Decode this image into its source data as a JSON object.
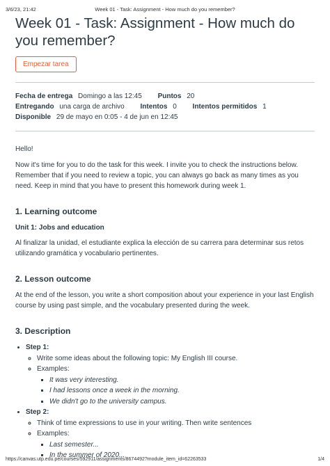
{
  "print_header": {
    "datetime": "3/6/23, 21:42",
    "page_title": "Week 01 - Task: Assignment - How much do you remember?"
  },
  "title": "Week 01 - Task: Assignment - How much do you remember?",
  "start_button": "Empezar tarea",
  "details": {
    "due_label": "Fecha de entrega",
    "due_value": "Domingo a las 12:45",
    "points_label": "Puntos",
    "points_value": "20",
    "submitting_label": "Entregando",
    "submitting_value": "una carga de archivo",
    "attempts_label": "Intentos",
    "attempts_value": "0",
    "allowed_label": "Intentos permitidos",
    "allowed_value": "1",
    "available_label": "Disponible",
    "available_value": "29 de mayo en 0:05 - 4 de jun en 12:45"
  },
  "intro": {
    "greeting": "Hello!",
    "paragraph": "Now it's time for you to do the task for this week. I invite you to check the instructions below. Remember that if you need to review a topic, you can always go back as many times as you need. Keep in mind that you have to present this homework during week 1."
  },
  "section1": {
    "heading": "1. Learning outcome",
    "subheading": "Unit 1: Jobs and education",
    "text": "Al finalizar la unidad, el estudiante explica la elección de su carrera para determinar sus retos utilizando gramática y vocabulario pertinentes."
  },
  "section2": {
    "heading": "2. Lesson outcome",
    "text": "At the end of the lesson, you write a short composition about your experience in your last English course by using past simple, and the vocabulary presented during the week."
  },
  "section3": {
    "heading": "3. Description",
    "step1": {
      "label": "Step 1:",
      "instruction": "Write some ideas about the following topic: My English III course.",
      "examples_label": "Examples:",
      "examples": [
        "It was very interesting.",
        "I had lessons once a week in the morning.",
        "We didn't go to the university campus."
      ]
    },
    "step2": {
      "label": "Step 2:",
      "instruction": "Think of time expressions to use in your writing. Then write sentences",
      "examples_label": "Examples:",
      "examples": [
        "Last semester...",
        "In the summer of 2020..."
      ]
    }
  },
  "print_footer": {
    "url": "https://canvas.utp.edu.pe/courses/592911/assignments/8674492?module_item_id=62263533",
    "page_number": "1/4"
  }
}
